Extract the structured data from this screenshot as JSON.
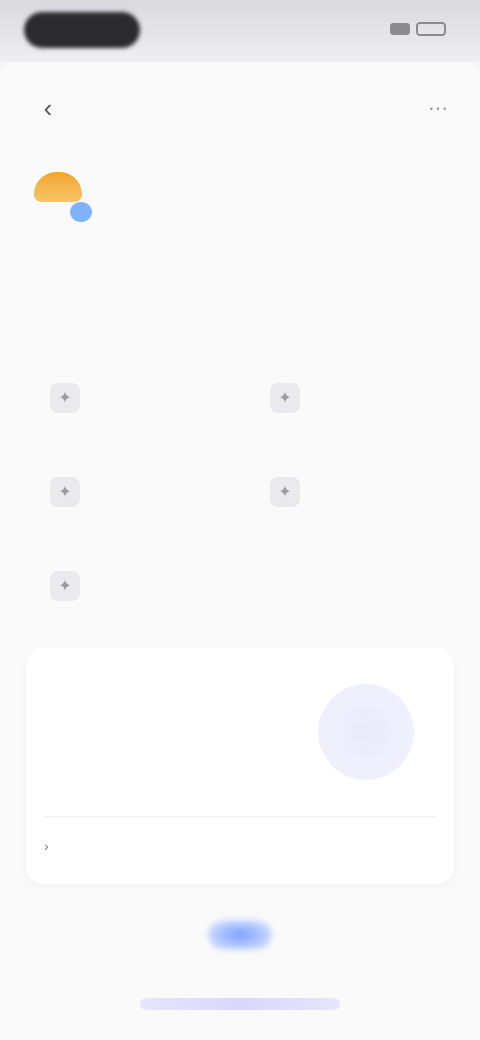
{
  "status": {
    "time": "",
    "icons": [
      "signal-icon",
      "battery-icon"
    ]
  },
  "header": {
    "back_icon": "back-arrow-icon",
    "more_icon": "more-icon"
  },
  "app": {
    "name": "",
    "subtitle": "",
    "description": ""
  },
  "features": [
    {
      "icon": "feature-icon-1",
      "title": "",
      "subtitle": ""
    },
    {
      "icon": "feature-icon-2",
      "title": "",
      "subtitle": ""
    },
    {
      "icon": "feature-icon-3",
      "title": "",
      "subtitle": ""
    },
    {
      "icon": "feature-icon-4",
      "title": "",
      "subtitle": ""
    },
    {
      "icon": "feature-icon-5",
      "title": "",
      "subtitle": ""
    }
  ],
  "promo": {
    "title": "",
    "body": "",
    "link_label": ""
  },
  "footer": {
    "price": "",
    "price_sub": "",
    "cta_label": "",
    "terms": ""
  },
  "colors": {
    "accent": "#7aa0ff",
    "logo_orange": "#f3a530",
    "background": "#fafafa"
  }
}
